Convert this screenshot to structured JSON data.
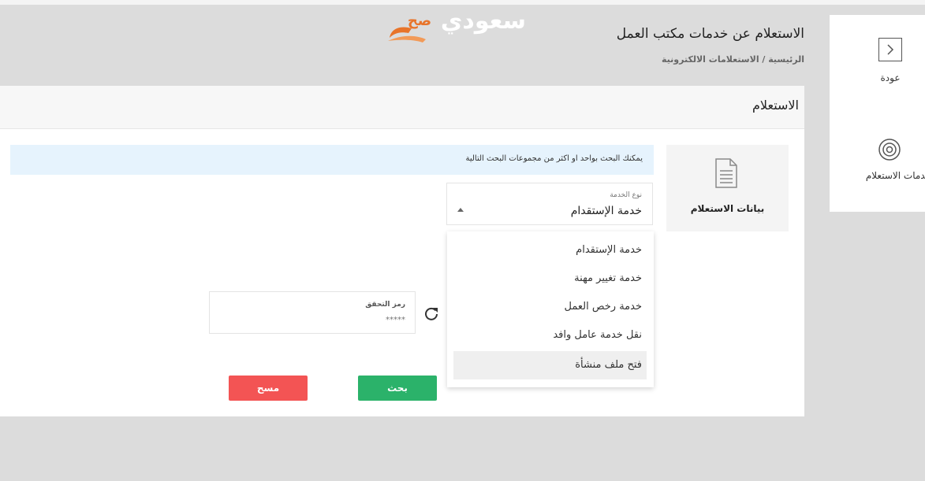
{
  "header": {
    "title": "الاستعلام عن خدمات مكتب العمل",
    "breadcrumb": "الرئيسية / الاستعلامات الالكترونية"
  },
  "logo": {
    "text": "سعودي",
    "badge": "صح"
  },
  "sidebar": {
    "back_label": "عودة",
    "services_label": "خدمات الاستعلام"
  },
  "card": {
    "title": "الاستعلام",
    "info": "يمكنك البحث بواحد او اكثر من مجموعات البحث التالية",
    "data_tile_label": "بيانات الاستعلام"
  },
  "service_select": {
    "label": "نوع الخدمة",
    "value": "خدمة الإستقدام",
    "options": [
      "خدمة الإستقدام",
      "خدمة تغيير مهنة",
      "خدمة رخص العمل",
      "نقل خدمة عامل وافد",
      "فتح ملف منشأة"
    ],
    "highlighted_index": 4
  },
  "captcha": {
    "label": "رمز التحقق",
    "placeholder": "*****"
  },
  "buttons": {
    "search": "بحث",
    "clear": "مسح"
  },
  "colors": {
    "search": "#2bb26a",
    "clear": "#f35454",
    "info_bg": "#e6f3fd",
    "logo_accent": "#e8742a"
  }
}
